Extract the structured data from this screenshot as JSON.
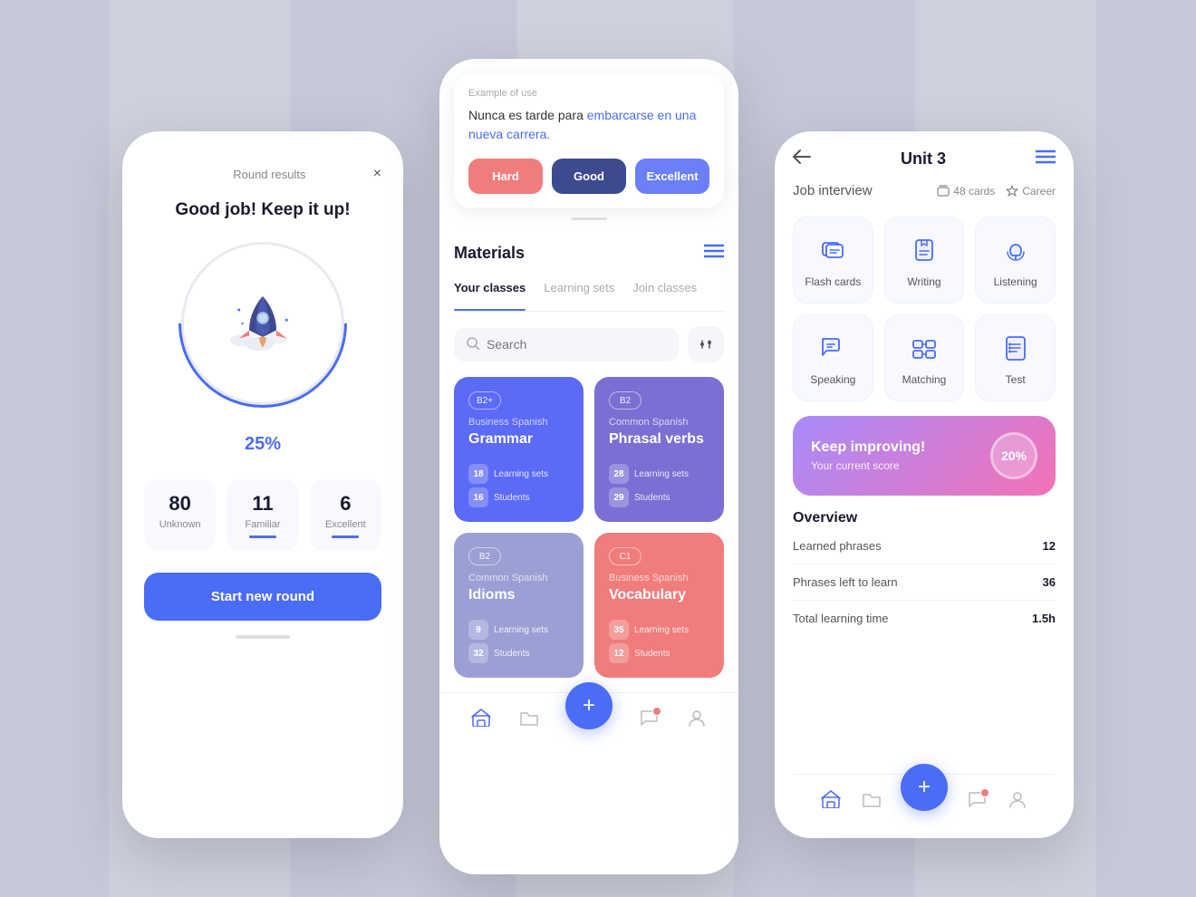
{
  "background": {
    "color": "#c5c8d8"
  },
  "phone1": {
    "header": "Round results",
    "close_icon": "×",
    "congrats": "Good job! Keep it up!",
    "percent": "25",
    "percent_symbol": "%",
    "stats": [
      {
        "value": "80",
        "label": "Unknown"
      },
      {
        "value": "11",
        "label": "Familiar"
      },
      {
        "value": "6",
        "label": "Excellent"
      }
    ],
    "start_btn": "Start new round"
  },
  "phone2": {
    "top_card": {
      "example_label": "Example of use",
      "example_text": "Nunca es tarde para ",
      "example_link": "embarcarse en una nueva carrera.",
      "buttons": {
        "hard": "Hard",
        "good": "Good",
        "excellent": "Excellent"
      }
    },
    "title": "Materials",
    "tabs": [
      "Your classes",
      "Learning sets",
      "Join classes"
    ],
    "search_placeholder": "Search",
    "cards": [
      {
        "level": "B2+",
        "category": "Business Spanish",
        "name": "Grammar",
        "learning_sets": 18,
        "students": 16,
        "color": "card-blue"
      },
      {
        "level": "B2",
        "category": "Common Spanish",
        "name": "Phrasal verbs",
        "learning_sets": 28,
        "students": 29,
        "color": "card-purple"
      },
      {
        "level": "B2",
        "category": "Common Spanish",
        "name": "Idioms",
        "learning_sets": 9,
        "students": 32,
        "color": "card-light-purple"
      },
      {
        "level": "C1",
        "category": "Business Spanish",
        "name": "Vocabulary",
        "learning_sets": 35,
        "students": 12,
        "color": "card-coral"
      }
    ]
  },
  "phone3": {
    "title": "Unit 3",
    "back_icon": "←",
    "menu_icon": "☰",
    "subtitle": "Job interview",
    "cards_count": "48 cards",
    "category": "Career",
    "activities": [
      {
        "label": "Flash cards"
      },
      {
        "label": "Writing"
      },
      {
        "label": "Listening"
      },
      {
        "label": "Speaking"
      },
      {
        "label": "Matching"
      },
      {
        "label": "Test"
      }
    ],
    "progress": {
      "title": "Keep improving!",
      "subtitle": "Your current score",
      "percent": "20%"
    },
    "overview": {
      "title": "Overview",
      "items": [
        {
          "label": "Learned phrases",
          "value": "12"
        },
        {
          "label": "Phrases left to learn",
          "value": "36"
        },
        {
          "label": "Total learning time",
          "value": "1.5h"
        }
      ]
    }
  }
}
